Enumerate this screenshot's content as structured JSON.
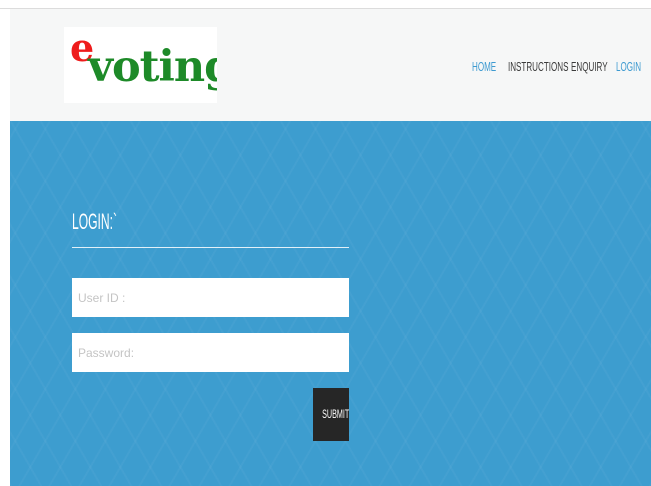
{
  "header": {
    "logo": {
      "e": "e",
      "word": "voting"
    },
    "nav": [
      {
        "label": "HOME",
        "active": true
      },
      {
        "label": "INSTRUCTIONS",
        "active": false
      },
      {
        "label": "ENQUIRY",
        "active": false
      },
      {
        "label": "LOGIN",
        "active": true
      }
    ]
  },
  "login": {
    "heading": "LOGIN:`",
    "userid": {
      "value": "",
      "placeholder": "User ID :"
    },
    "password": {
      "value": "",
      "placeholder": "Password:"
    },
    "submit_label": "SUBMIT"
  },
  "colors": {
    "accent": "#3d9ad0",
    "hero_background": "#3d9dcf",
    "header_background": "#f6f7f7",
    "logo_e": "#ee1c1c",
    "logo_word": "#1d8a28",
    "submit_background": "#262626"
  }
}
